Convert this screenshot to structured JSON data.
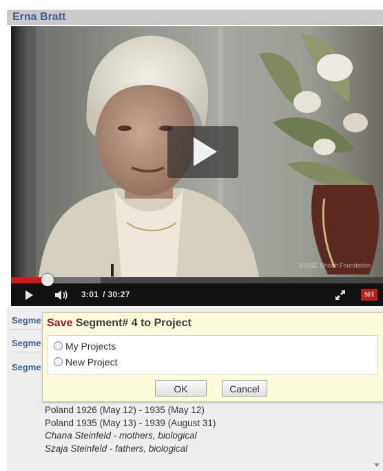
{
  "window": {
    "title": "Erna Bratt"
  },
  "player": {
    "current_time": "3:01",
    "total_time": "/ 30:27",
    "progress_fraction": 0.099,
    "buffered_fraction": 0.24,
    "watermark": "© USC Shoah Foundation",
    "logo_text": "SFI"
  },
  "segments": {
    "label": "Segme"
  },
  "dialog": {
    "title_save": "Save",
    "title_rest": "Segment# 4 to Project",
    "options": [
      "My Projects",
      "New Project"
    ],
    "ok_label": "OK",
    "cancel_label": "Cancel"
  },
  "details": {
    "lines": [
      "Poland 1926 (May 12) - 1935 (May 12)",
      "Poland 1935 (May 13) - 1939 (August 31)"
    ],
    "italic_lines": [
      "Chana Steinfeld - mothers, biological",
      "Szaja Steinfeld - fathers, biological"
    ]
  },
  "icons": {
    "play_overlay": "play-icon",
    "play": "play-icon",
    "volume": "volume-icon",
    "fullscreen": "fullscreen-icon",
    "scroll": "chevron-down-icon"
  },
  "colors": {
    "title": "#3f5f8f",
    "save": "#a3161b",
    "progress": "#cc1b1b",
    "dialog_bg": "#fcfcdc"
  }
}
